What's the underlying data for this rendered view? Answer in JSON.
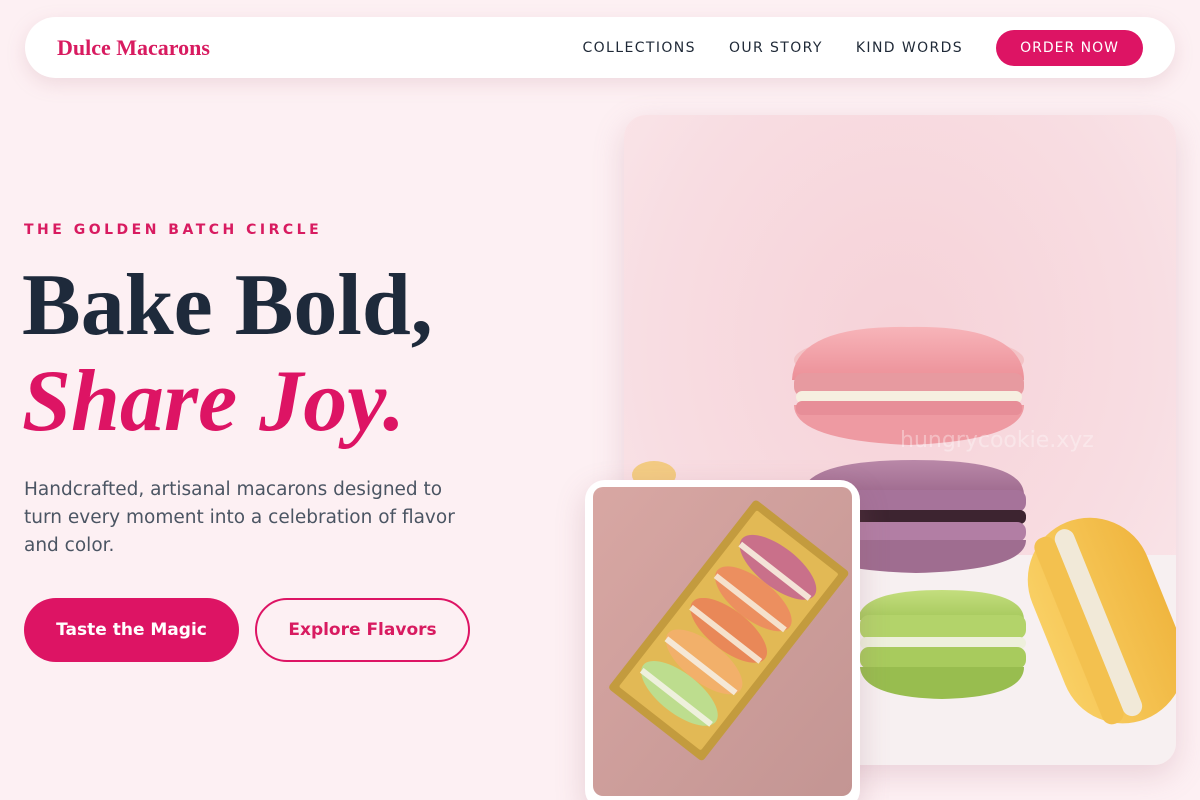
{
  "nav": {
    "brand": "Dulce Macarons",
    "links": [
      "COLLECTIONS",
      "OUR STORY",
      "KIND WORDS"
    ],
    "cta": "ORDER NOW"
  },
  "hero": {
    "eyebrow": "THE GOLDEN BATCH CIRCLE",
    "headline_line1": "Bake Bold,",
    "headline_line2": "Share Joy.",
    "description": "Handcrafted, artisanal macarons designed to turn every moment into a celebration of flavor and color.",
    "primary_button": "Taste the Magic",
    "secondary_button": "Explore Flavors"
  },
  "images": {
    "main": "macaron-stack-photo",
    "secondary": "macaron-box-photo"
  },
  "colors": {
    "accent": "#dd1464",
    "background": "#fdf0f3",
    "heading": "#1e2a3b",
    "body_text": "#4b5563"
  }
}
